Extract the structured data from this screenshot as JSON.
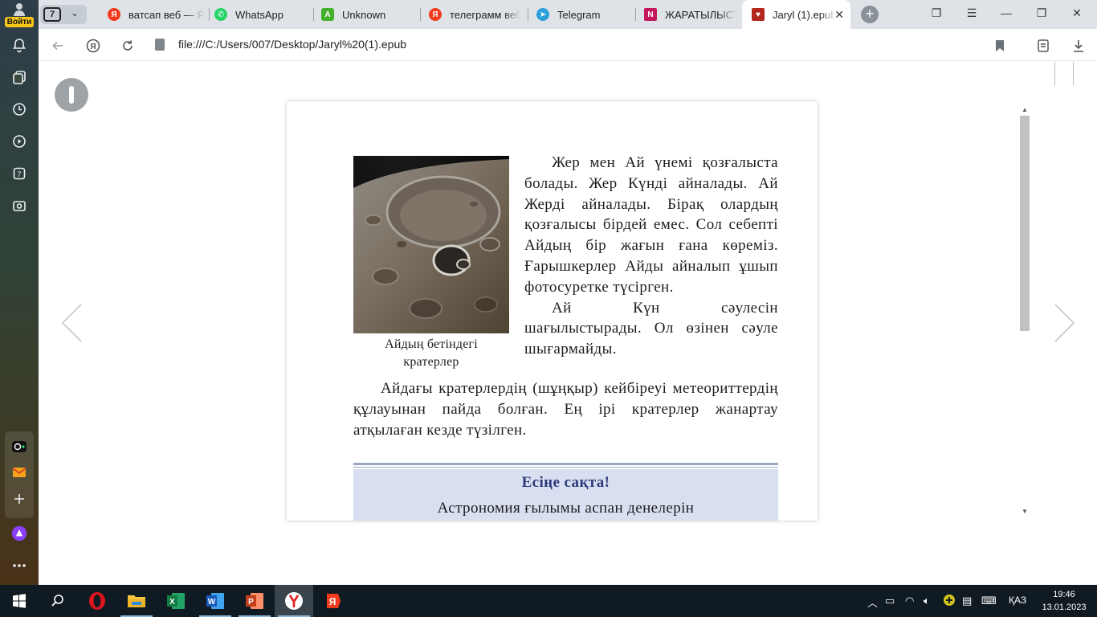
{
  "sidebar": {
    "login_label": "Войти",
    "items": [
      "bell-icon",
      "collections-icon",
      "history-icon",
      "video-icon",
      "tab-count-icon",
      "screenshot-icon"
    ],
    "tab_count_badge": "7",
    "apps": [
      "alice-app-icon",
      "mail-app-icon",
      "add-app-icon"
    ]
  },
  "tabs": {
    "count": "7",
    "items": [
      {
        "title": "ватсап веб — Я",
        "favicon": "yandex",
        "color": "#f33a1d"
      },
      {
        "title": "WhatsApp",
        "favicon": "whatsapp",
        "color": "#25d366"
      },
      {
        "title": "Unknown",
        "favicon": "unknown",
        "color": "#43b02a"
      },
      {
        "title": "телеграмм веб",
        "favicon": "yandex",
        "color": "#f33a1d"
      },
      {
        "title": "Telegram",
        "favicon": "telegram",
        "color": "#2aa0da"
      },
      {
        "title": "ЖАРАТЫЛЫСТА",
        "favicon": "book",
        "color": "#c2185b"
      },
      {
        "title": "Jaryl (1).epub",
        "favicon": "epub",
        "color": "#b3261e"
      }
    ],
    "new_tab": "+"
  },
  "address_bar": {
    "url": "file:///C:/Users/007/Desktop/Jaryl%20(1).epub"
  },
  "book": {
    "caption_line1": "Айдың бетіндегі",
    "caption_line2": "кратерлер",
    "para1": "Жер мен Ай үнемі қозғалыста болады. Жер Күнді айналады. Ай Жерді айналады. Бірақ олардың қозғалысы бірдей емес. Сол себепті Айдың бір жағын ғана көреміз. Ғарышкерлер Айды айналып ұшып фотосуретке түсірген.",
    "para2": "Ай Күн сәулесін шағылыстырады. Ол өзінен сәуле шығармайды.",
    "para3": "Айдағы кратерлердің (шұңқыр) кейбіреуі метеориттердің құлауынан пайда болған. Ең ірі кратерлер жанартау атқылаған кезде түзілген.",
    "note_title": "Есіңе сақта!",
    "note_text": "Астрономия ғылымы аспан денелерін"
  },
  "taskbar": {
    "apps": [
      "start",
      "search",
      "opera",
      "file-explorer",
      "excel",
      "word",
      "powerpoint",
      "yandex-browser",
      "yandex"
    ],
    "language": "ҚАЗ",
    "time": "19:46",
    "date": "13.01.2023"
  }
}
